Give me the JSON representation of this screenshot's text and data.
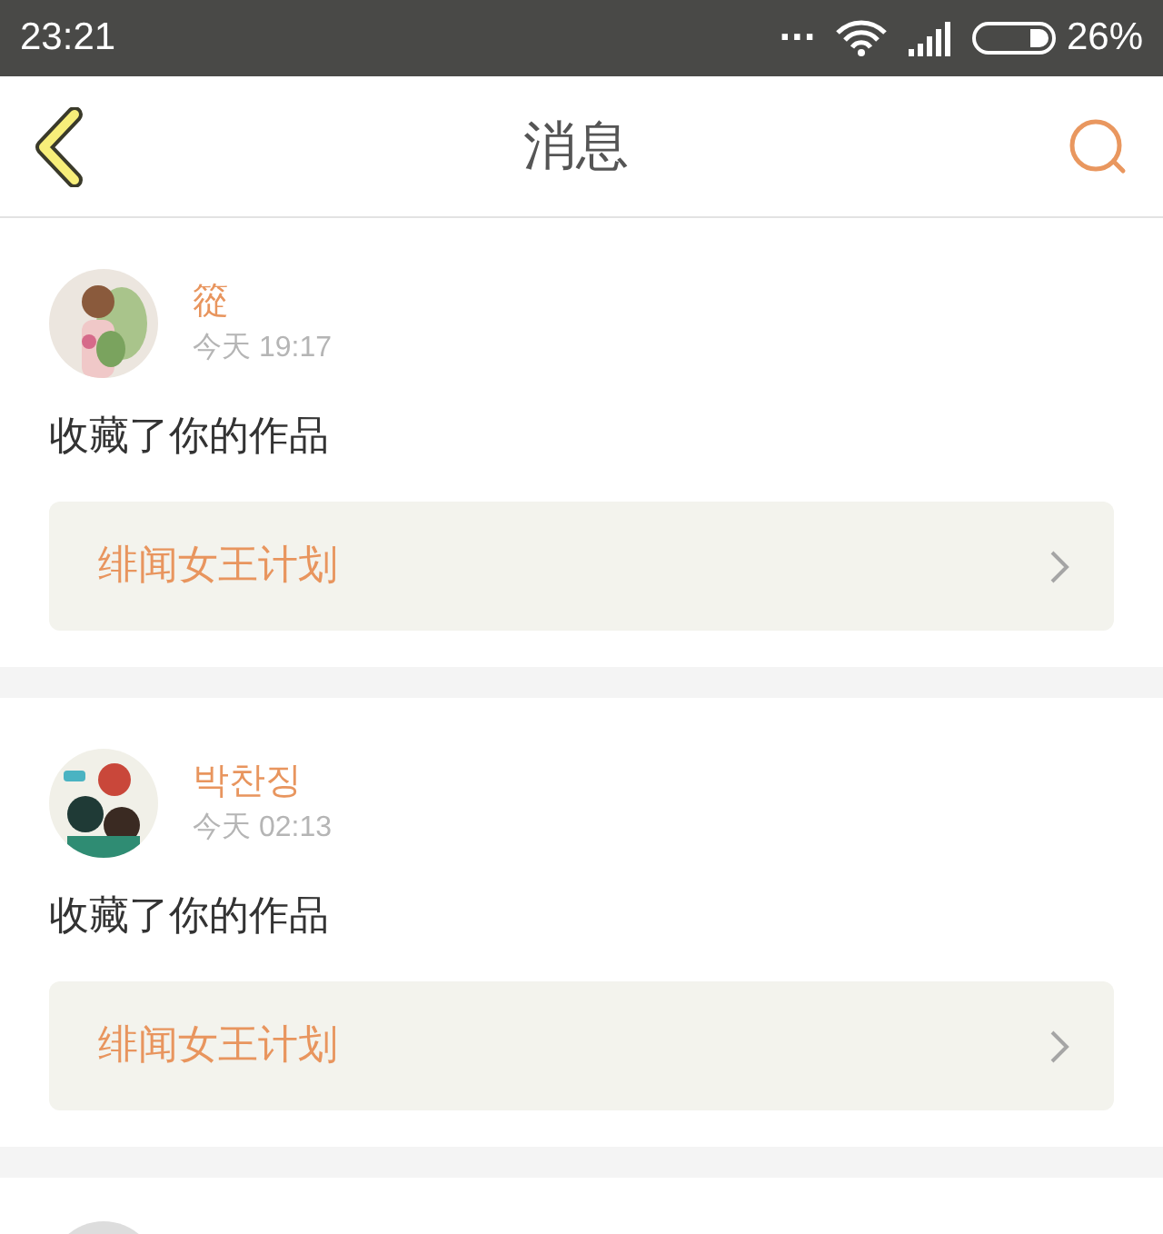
{
  "status_bar": {
    "time": "23:21",
    "ellipsis": "...",
    "battery": "26%"
  },
  "header": {
    "title": "消息"
  },
  "messages": [
    {
      "kind": "full",
      "name": "篵",
      "time": "今天 19:17",
      "action": "收藏了你的作品",
      "work": "绯闻女王计划"
    },
    {
      "kind": "full",
      "name": "박찬징",
      "time": "今天 02:13",
      "action": "收藏了你的作品",
      "work": "绯闻女王计划"
    },
    {
      "kind": "partial"
    }
  ]
}
